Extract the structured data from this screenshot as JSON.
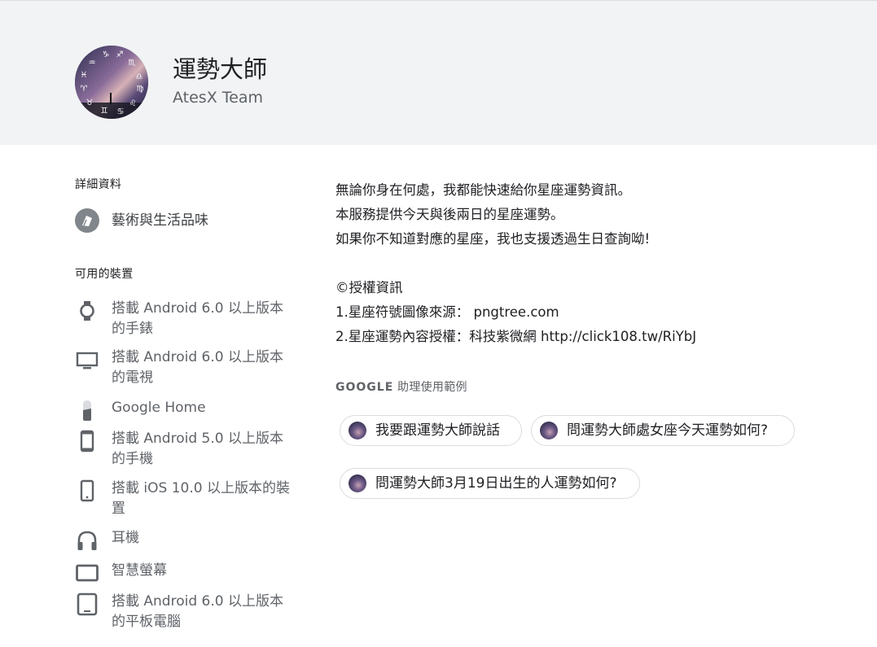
{
  "app": {
    "title": "運勢大師",
    "developer": "AtesX Team"
  },
  "sidebar": {
    "details_heading": "詳細資料",
    "category": {
      "label": "藝術與生活品味",
      "icon": "art-category-icon"
    },
    "devices_heading": "可用的裝置",
    "devices": [
      {
        "label": "搭載 Android 6.0 以上版本的手錶",
        "icon": "watch-icon"
      },
      {
        "label": "搭載 Android 6.0 以上版本的電視",
        "icon": "tv-icon"
      },
      {
        "label": "Google Home",
        "icon": "google-home-icon"
      },
      {
        "label": "搭載 Android 5.0 以上版本的手機",
        "icon": "phone-icon"
      },
      {
        "label": "搭載 iOS 10.0 以上版本的裝置",
        "icon": "phone-icon"
      },
      {
        "label": "耳機",
        "icon": "headphones-icon"
      },
      {
        "label": "智慧螢幕",
        "icon": "smart-display-icon"
      },
      {
        "label": "搭載 Android 6.0 以上版本的平板電腦",
        "icon": "tablet-icon"
      }
    ]
  },
  "description": {
    "lines": [
      "無論你身在何處，我都能快速給你星座運勢資訊。",
      "本服務提供今天與後兩日的星座運勢。",
      "如果你不知道對應的星座，我也支援透過生日查詢呦!",
      "",
      "©授權資訊",
      "1.星座符號圖像來源： pngtree.com",
      "2.星座運勢內容授權：科技紫微網  http://click108.tw/RiYbJ"
    ]
  },
  "examples": {
    "heading_brand": "GOOGLE",
    "heading_rest": " 助理使用範例",
    "chips": [
      "我要跟運勢大師說話",
      "問運勢大師處女座今天運勢如何?",
      "問運勢大師3月19日出生的人運勢如何?"
    ]
  },
  "colors": {
    "header_bg": "#f1f3f4",
    "icon_grey": "#80868b",
    "text_primary": "#202124",
    "text_secondary": "#5f6368"
  }
}
